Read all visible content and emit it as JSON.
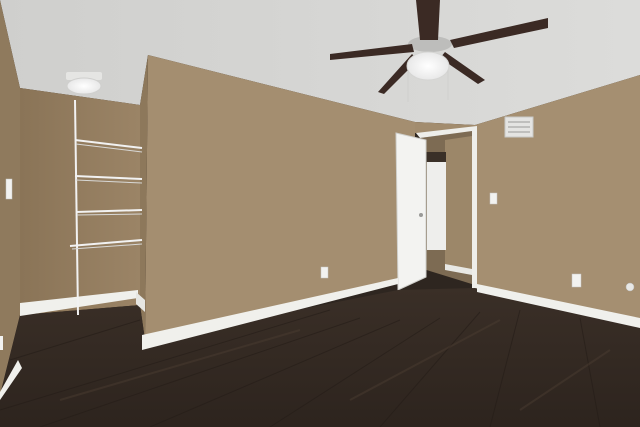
{
  "scene": {
    "subject": "empty-bedroom",
    "colors": {
      "wall": "#a38d6f",
      "wall_shadow": "#8a7659",
      "ceiling": "#d9d9d7",
      "floor": "#3d3129",
      "floor_dark": "#2a211b",
      "trim": "#f2f2ef",
      "fan_blade": "#3a2a24",
      "door": "#f4f4f2"
    }
  }
}
